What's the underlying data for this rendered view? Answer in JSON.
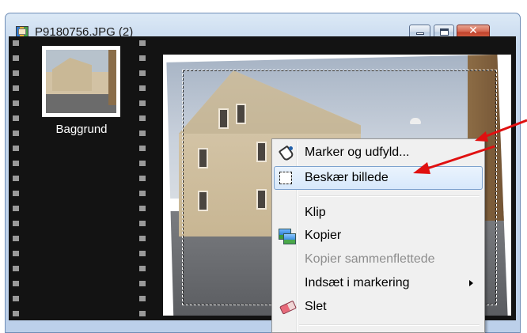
{
  "window": {
    "title": "P9180756.JPG (2)",
    "close_glyph": "✕"
  },
  "layers_panel": {
    "layers": [
      {
        "label": "Baggrund"
      }
    ]
  },
  "context_menu": {
    "items": [
      {
        "label": "Marker og udfyld...",
        "icon": "fill-selection-icon",
        "enabled": true
      },
      {
        "label": "Beskær billede",
        "icon": "crop-icon",
        "enabled": true,
        "highlighted": true
      },
      {
        "label": "Klip",
        "enabled": true
      },
      {
        "label": "Kopier",
        "icon": "copy-icon",
        "enabled": true
      },
      {
        "label": "Kopier sammenflettede",
        "enabled": false
      },
      {
        "label": "Indsæt i markering",
        "enabled": true,
        "has_submenu": true
      },
      {
        "label": "Slet",
        "icon": "eraser-icon",
        "enabled": true
      }
    ]
  },
  "annotation": {
    "color": "#e01010"
  }
}
